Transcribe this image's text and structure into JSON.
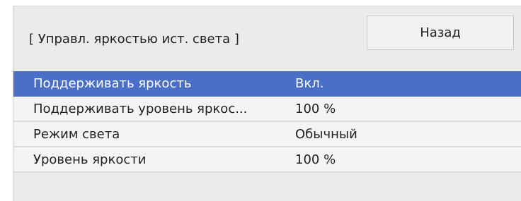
{
  "header": {
    "title": "[ Управл. яркостью ист. света ]",
    "back_label": "Назад"
  },
  "menu": {
    "items": [
      {
        "label": "Поддерживать яркость",
        "value": "Вкл.",
        "selected": true
      },
      {
        "label": "Поддерживать уровень яркос...",
        "value": "100 %",
        "selected": false
      },
      {
        "label": "Режим света",
        "value": "Обычный",
        "selected": false
      },
      {
        "label": "Уровень яркости",
        "value": "100 %",
        "selected": false
      }
    ]
  },
  "colors": {
    "selected_row": "#4b6fc6",
    "panel_background": "#ebebeb",
    "row_background": "#f4f4f4"
  }
}
